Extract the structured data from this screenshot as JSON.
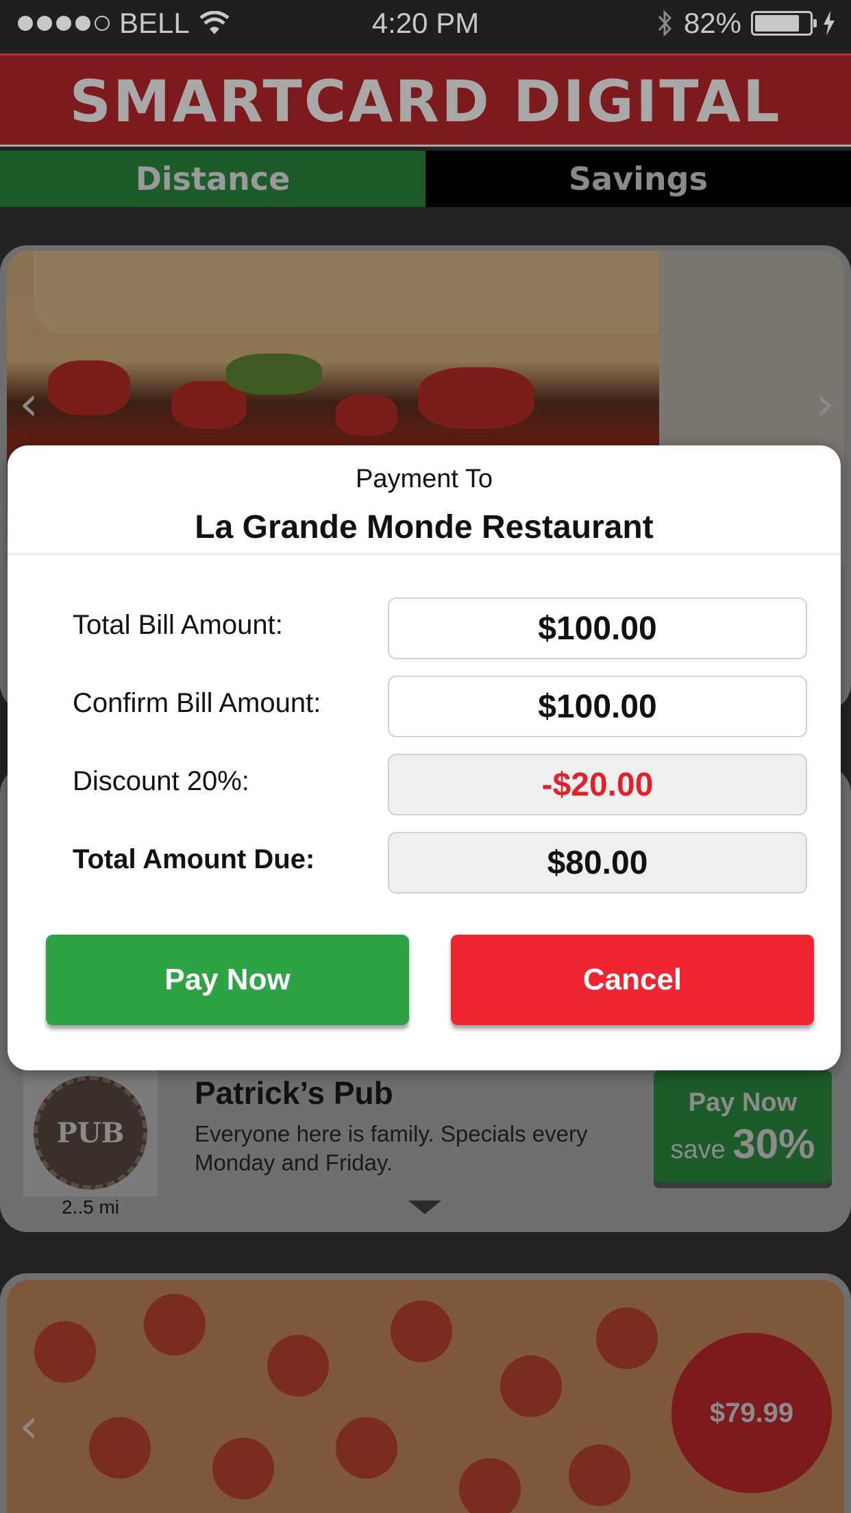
{
  "status_bar": {
    "carrier": "BELL",
    "time": "4:20 PM",
    "battery": "82%",
    "battery_level": 0.82
  },
  "header": {
    "logo_text": "SMARTCARD DIGITAL"
  },
  "tabs": [
    {
      "label": "Distance",
      "active": true
    },
    {
      "label": "Savings",
      "active": false
    }
  ],
  "modal": {
    "payment_to_label": "Payment To",
    "restaurant_name": "La Grande Monde Restaurant",
    "rows": [
      {
        "label": "Total Bill Amount:",
        "value": "$100.00"
      },
      {
        "label": "Confirm Bill Amount:",
        "value": "$100.00"
      },
      {
        "label": "Discount 20%:",
        "value": "-$20.00"
      },
      {
        "label": "Total Amount Due:",
        "value": "$80.00"
      }
    ],
    "pay_button": "Pay Now",
    "cancel_button": "Cancel"
  },
  "listing": {
    "name": "Patrick’s Pub",
    "description": "Everyone here is family.  Specials every Monday and Friday.",
    "distance": "2..5 mi",
    "pay_label": "Pay Now",
    "save_prefix": "save",
    "save_percent": "30%",
    "logo_text": "PUB"
  },
  "price_bubble": "$79.99",
  "colors": {
    "brand_red": "#7d1a1d",
    "active_tab_green": "#1d5b2a",
    "pay_green": "#2da346",
    "cancel_red": "#ee2631",
    "discount_red": "#e0232b"
  }
}
